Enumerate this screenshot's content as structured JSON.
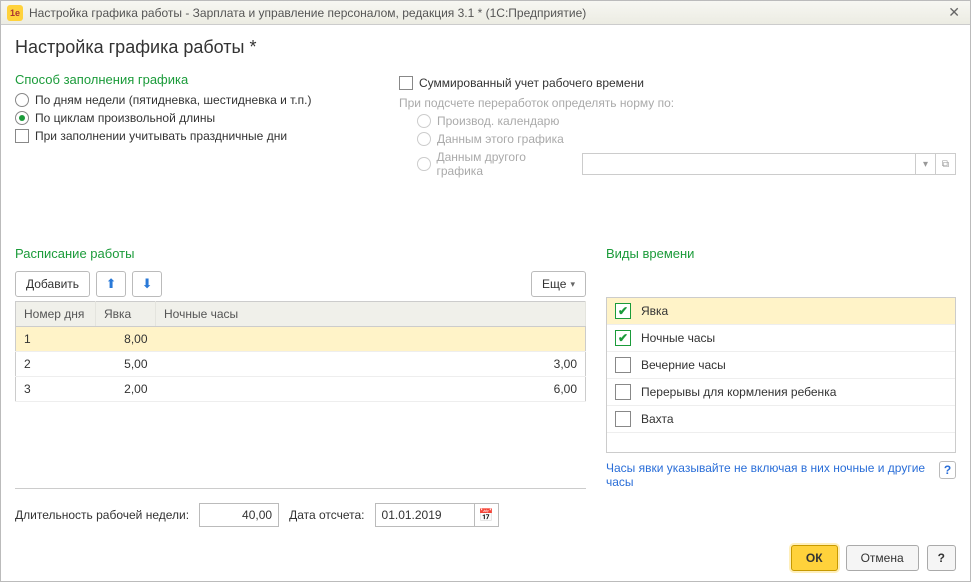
{
  "window": {
    "title": "Настройка графика работы - Зарплата и управление персоналом, редакция 3.1 * (1С:Предприятие)",
    "logo_text": "1e"
  },
  "page_title": "Настройка графика работы *",
  "fill_method": {
    "title": "Способ заполнения графика",
    "opt_weekdays": "По дням недели (пятидневка, шестидневка и т.п.)",
    "opt_cycles": "По циклам произвольной длины",
    "chk_holidays": "При заполнении учитывать праздничные дни"
  },
  "summarized": {
    "chk_label": "Суммированный учет рабочего времени",
    "norm_label": "При подсчете переработок определять норму по:",
    "opt_calendar": "Производ. календарю",
    "opt_this": "Данным этого графика",
    "opt_other": "Данным другого графика"
  },
  "schedule": {
    "title": "Расписание работы",
    "btn_add": "Добавить",
    "btn_more": "Еще",
    "col_daynum": "Номер дня",
    "col_presence": "Явка",
    "col_night": "Ночные часы",
    "rows": [
      {
        "n": "1",
        "presence": "8,00",
        "night": ""
      },
      {
        "n": "2",
        "presence": "5,00",
        "night": "3,00"
      },
      {
        "n": "3",
        "presence": "2,00",
        "night": "6,00"
      }
    ]
  },
  "time_types": {
    "title": "Виды времени",
    "items": [
      {
        "label": "Явка",
        "checked": true,
        "selected": true
      },
      {
        "label": "Ночные часы",
        "checked": true,
        "selected": false
      },
      {
        "label": "Вечерние часы",
        "checked": false,
        "selected": false
      },
      {
        "label": "Перерывы для кормления ребенка",
        "checked": false,
        "selected": false
      },
      {
        "label": "Вахта",
        "checked": false,
        "selected": false
      }
    ],
    "hint": "Часы явки указывайте не включая в них ночные и другие часы"
  },
  "bottom": {
    "week_len_label": "Длительность рабочей недели:",
    "week_len_value": "40,00",
    "start_date_label": "Дата отсчета:",
    "start_date_value": "01.01.2019"
  },
  "footer": {
    "ok": "ОК",
    "cancel": "Отмена",
    "help": "?"
  }
}
